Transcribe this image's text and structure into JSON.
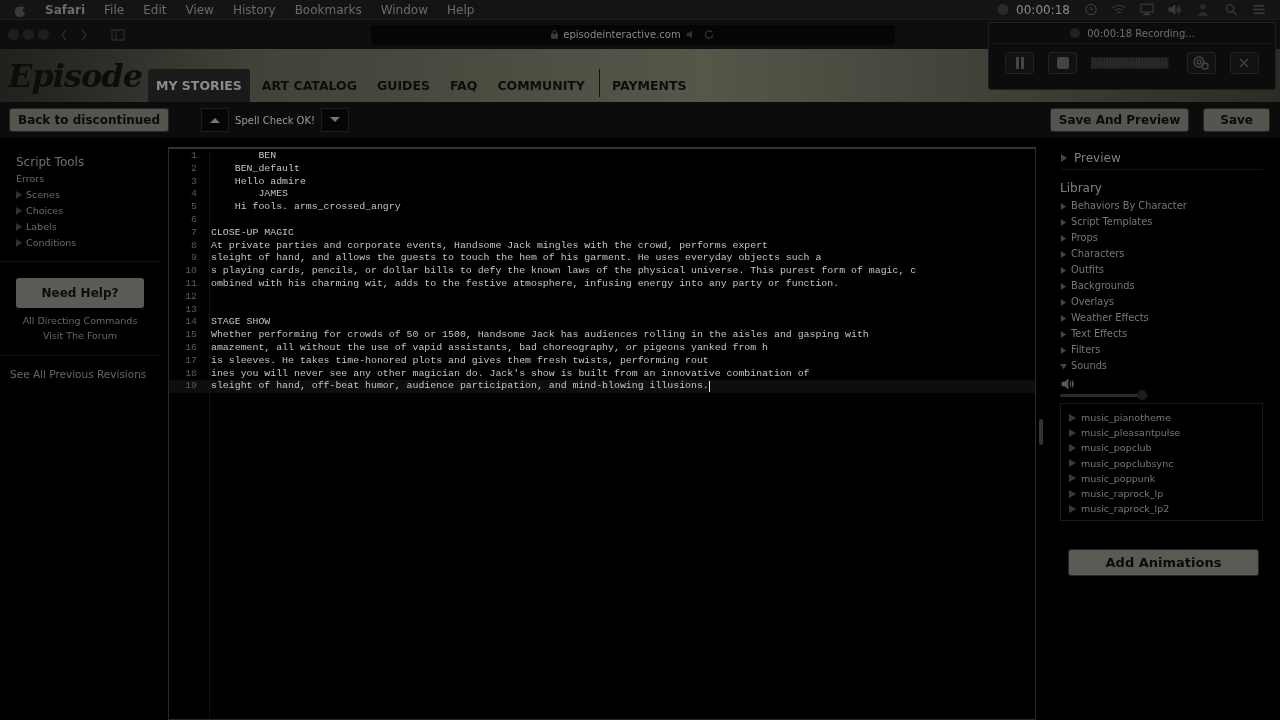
{
  "menu_bar": {
    "app": "Safari",
    "items": [
      "File",
      "Edit",
      "View",
      "History",
      "Bookmarks",
      "Window",
      "Help"
    ],
    "recording_time": "00:00:18"
  },
  "browser": {
    "url": "episodeinteractive.com"
  },
  "site": {
    "logo": "Episode",
    "nav": [
      {
        "label": "MY STORIES",
        "selected": true
      },
      {
        "label": "ART CATALOG",
        "selected": false
      },
      {
        "label": "GUIDES",
        "selected": false
      },
      {
        "label": "FAQ",
        "selected": false
      },
      {
        "label": "COMMUNITY",
        "selected": false
      },
      {
        "label": "PAYMENTS",
        "selected": false
      }
    ]
  },
  "recorder": {
    "status": "00:00:18 Recording..."
  },
  "toolbar": {
    "back_button": "Back to discontinued",
    "spell_check": "Spell Check OK!",
    "save_preview_button": "Save And Preview",
    "save_button": "Save"
  },
  "script_tools": {
    "title": "Script Tools",
    "errors": "Errors",
    "sections": [
      "Scenes",
      "Choices",
      "Labels",
      "Conditions"
    ],
    "help_button": "Need Help?",
    "links": [
      "All Directing Commands",
      "Visit The Forum"
    ],
    "revisions_link": "See All Previous Revisions"
  },
  "editor": {
    "lines": [
      {
        "number": "1",
        "text": "        BEN",
        "selected": false
      },
      {
        "number": "2",
        "text": "    BEN_default",
        "selected": false
      },
      {
        "number": "3",
        "text": "    Hello admire",
        "selected": false
      },
      {
        "number": "4",
        "text": "        JAMES",
        "selected": false
      },
      {
        "number": "5",
        "text": "    Hi fools. arms_crossed_angry",
        "selected": false
      },
      {
        "number": "6",
        "selected": false
      },
      {
        "number": "7",
        "text": "CLOSE-UP MAGIC",
        "selected": false
      },
      {
        "number": "8",
        "text": "At private parties and corporate events, Handsome Jack mingles with the crowd, performs expert",
        "selected": false
      },
      {
        "number": "9",
        "text": "sleight of hand, and allows the guests to touch the hem of his garment. He uses everyday objects such a",
        "selected": false
      },
      {
        "number": "10",
        "text": "s playing cards, pencils, or dollar bills to defy the known laws of the physical universe. This purest form of magic, c",
        "selected": false
      },
      {
        "number": "11",
        "text": "ombined with his charming wit, adds to the festive atmosphere, infusing energy into any party or function.",
        "selected": false
      },
      {
        "number": "12",
        "selected": false
      },
      {
        "number": "13",
        "selected": false
      },
      {
        "number": "14",
        "text": "STAGE SHOW",
        "selected": false
      },
      {
        "number": "15",
        "text": "Whether performing for crowds of 50 or 1500, Handsome Jack has audiences rolling in the aisles and gasping with",
        "selected": false
      },
      {
        "number": "16",
        "text": "amazement, all without the use of vapid assistants, bad choreography, or pigeons yanked from h",
        "selected": false
      },
      {
        "number": "17",
        "text": "is sleeves. He takes time-honored plots and gives them fresh twists, performing rout",
        "selected": false
      },
      {
        "number": "18",
        "text": "ines you will never see any other magician do. Jack's show is built from an innovative combination of",
        "selected": false
      },
      {
        "number": "19",
        "text": "sleight of hand, off-beat humor, audience participation, and mind-blowing illusions.",
        "selected": true
      }
    ]
  },
  "right_panel": {
    "preview": "Preview",
    "library_title": "Library",
    "library": [
      {
        "label": "Behaviors By Character",
        "expanded": false
      },
      {
        "label": "Script Templates",
        "expanded": false
      },
      {
        "label": "Props",
        "expanded": false
      },
      {
        "label": "Characters",
        "expanded": false
      },
      {
        "label": "Outfits",
        "expanded": false
      },
      {
        "label": "Backgrounds",
        "expanded": false
      },
      {
        "label": "Overlays",
        "expanded": false
      },
      {
        "label": "Weather Effects",
        "expanded": false
      },
      {
        "label": "Text Effects",
        "expanded": false
      },
      {
        "label": "Filters",
        "expanded": false
      },
      {
        "label": "Sounds",
        "expanded": true
      }
    ],
    "volume": {
      "level": 0.93
    },
    "sounds": [
      "music_pianotheme",
      "music_pleasantpulse",
      "music_popclub",
      "music_popclubsync",
      "music_poppunk",
      "music_raprock_lp",
      "music_raprock_lp2"
    ],
    "add_button": "Add Animations"
  }
}
